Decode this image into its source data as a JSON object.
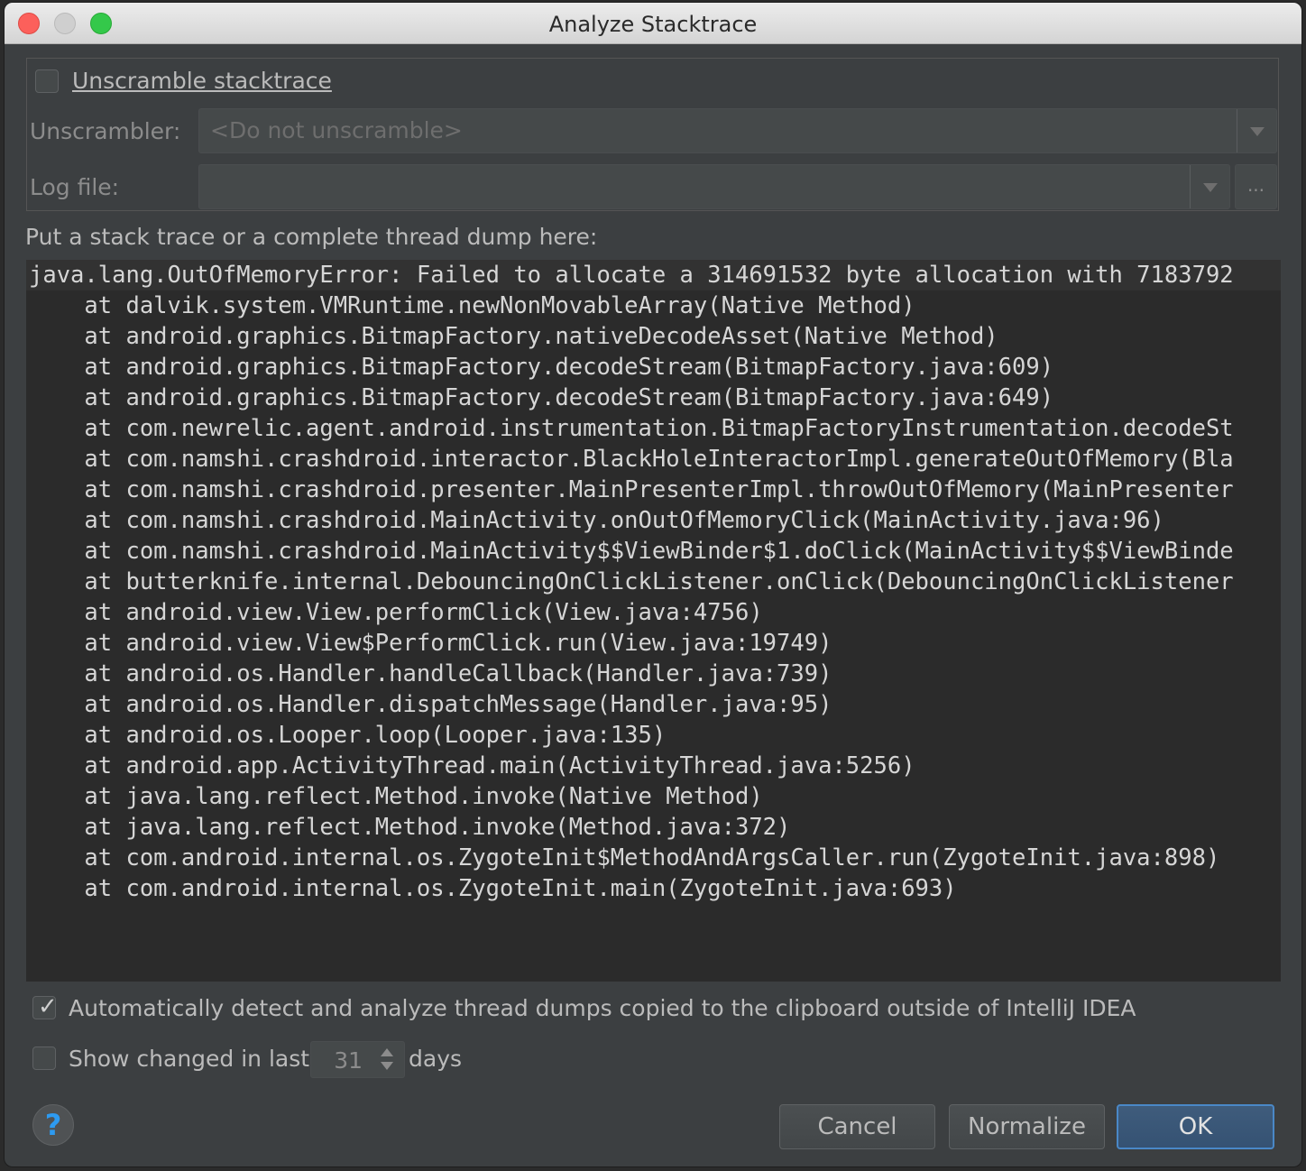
{
  "window": {
    "title": "Analyze Stacktrace"
  },
  "unscramble": {
    "checkbox_label": "Unscramble stacktrace",
    "unscrambler_label": "Unscrambler:",
    "unscrambler_value": "<Do not unscramble>",
    "logfile_label": "Log file:",
    "logfile_value": "",
    "browse_label": "..."
  },
  "prompt": "Put a stack trace or a complete thread dump here:",
  "trace_lines": [
    "java.lang.OutOfMemoryError: Failed to allocate a 314691532 byte allocation with 7183792",
    "    at dalvik.system.VMRuntime.newNonMovableArray(Native Method)",
    "    at android.graphics.BitmapFactory.nativeDecodeAsset(Native Method)",
    "    at android.graphics.BitmapFactory.decodeStream(BitmapFactory.java:609)",
    "    at android.graphics.BitmapFactory.decodeStream(BitmapFactory.java:649)",
    "    at com.newrelic.agent.android.instrumentation.BitmapFactoryInstrumentation.decodeSt",
    "    at com.namshi.crashdroid.interactor.BlackHoleInteractorImpl.generateOutOfMemory(Bla",
    "    at com.namshi.crashdroid.presenter.MainPresenterImpl.throwOutOfMemory(MainPresenter",
    "    at com.namshi.crashdroid.MainActivity.onOutOfMemoryClick(MainActivity.java:96)",
    "    at com.namshi.crashdroid.MainActivity$$ViewBinder$1.doClick(MainActivity$$ViewBinde",
    "    at butterknife.internal.DebouncingOnClickListener.onClick(DebouncingOnClickListener",
    "    at android.view.View.performClick(View.java:4756)",
    "    at android.view.View$PerformClick.run(View.java:19749)",
    "    at android.os.Handler.handleCallback(Handler.java:739)",
    "    at android.os.Handler.dispatchMessage(Handler.java:95)",
    "    at android.os.Looper.loop(Looper.java:135)",
    "    at android.app.ActivityThread.main(ActivityThread.java:5256)",
    "    at java.lang.reflect.Method.invoke(Native Method)",
    "    at java.lang.reflect.Method.invoke(Method.java:372)",
    "    at com.android.internal.os.ZygoteInit$MethodAndArgsCaller.run(ZygoteInit.java:898)",
    "    at com.android.internal.os.ZygoteInit.main(ZygoteInit.java:693)"
  ],
  "options": {
    "auto_detect_label": "Automatically detect and analyze thread dumps copied to the clipboard outside of IntelliJ IDEA",
    "auto_detect_checked": true,
    "show_changed_label": "Show changed in last",
    "show_changed_checked": false,
    "days_value": "31",
    "days_label": "days"
  },
  "buttons": {
    "help": "?",
    "cancel": "Cancel",
    "normalize": "Normalize",
    "ok": "OK"
  },
  "colors": {
    "dialog_bg": "#3c3f41",
    "editor_bg": "#2b2b2b",
    "ok_border": "#4a88c7",
    "help_icon": "#2d9af0"
  }
}
